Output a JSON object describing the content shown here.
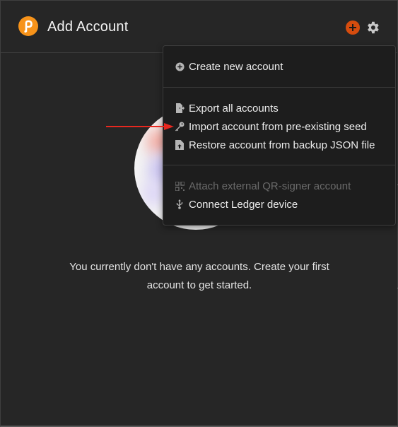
{
  "header": {
    "title": "Add Account",
    "brand_color": "#f7931a",
    "add_button_color": "#d54c0e",
    "logo_icon": "polkadot-logo-icon",
    "add_icon": "plus-circle-icon",
    "settings_icon": "gear-icon"
  },
  "menu": {
    "group1": [
      {
        "label": "Create new account",
        "icon": "plus-circle-icon",
        "disabled": false
      }
    ],
    "group2": [
      {
        "label": "Export all accounts",
        "icon": "file-export-icon",
        "disabled": false
      },
      {
        "label": "Import account from pre-existing seed",
        "icon": "key-icon",
        "disabled": false
      },
      {
        "label": "Restore account from backup JSON file",
        "icon": "file-upload-icon",
        "disabled": false
      }
    ],
    "group3": [
      {
        "label": "Attach external QR-signer account",
        "icon": "qrcode-icon",
        "disabled": true
      },
      {
        "label": "Connect Ledger device",
        "icon": "usb-icon",
        "disabled": false
      }
    ]
  },
  "main": {
    "empty_line1": "You currently don't have any accounts. Create your first",
    "empty_line2": "account to get started."
  },
  "annotation": {
    "arrow_color": "#e8281f"
  }
}
